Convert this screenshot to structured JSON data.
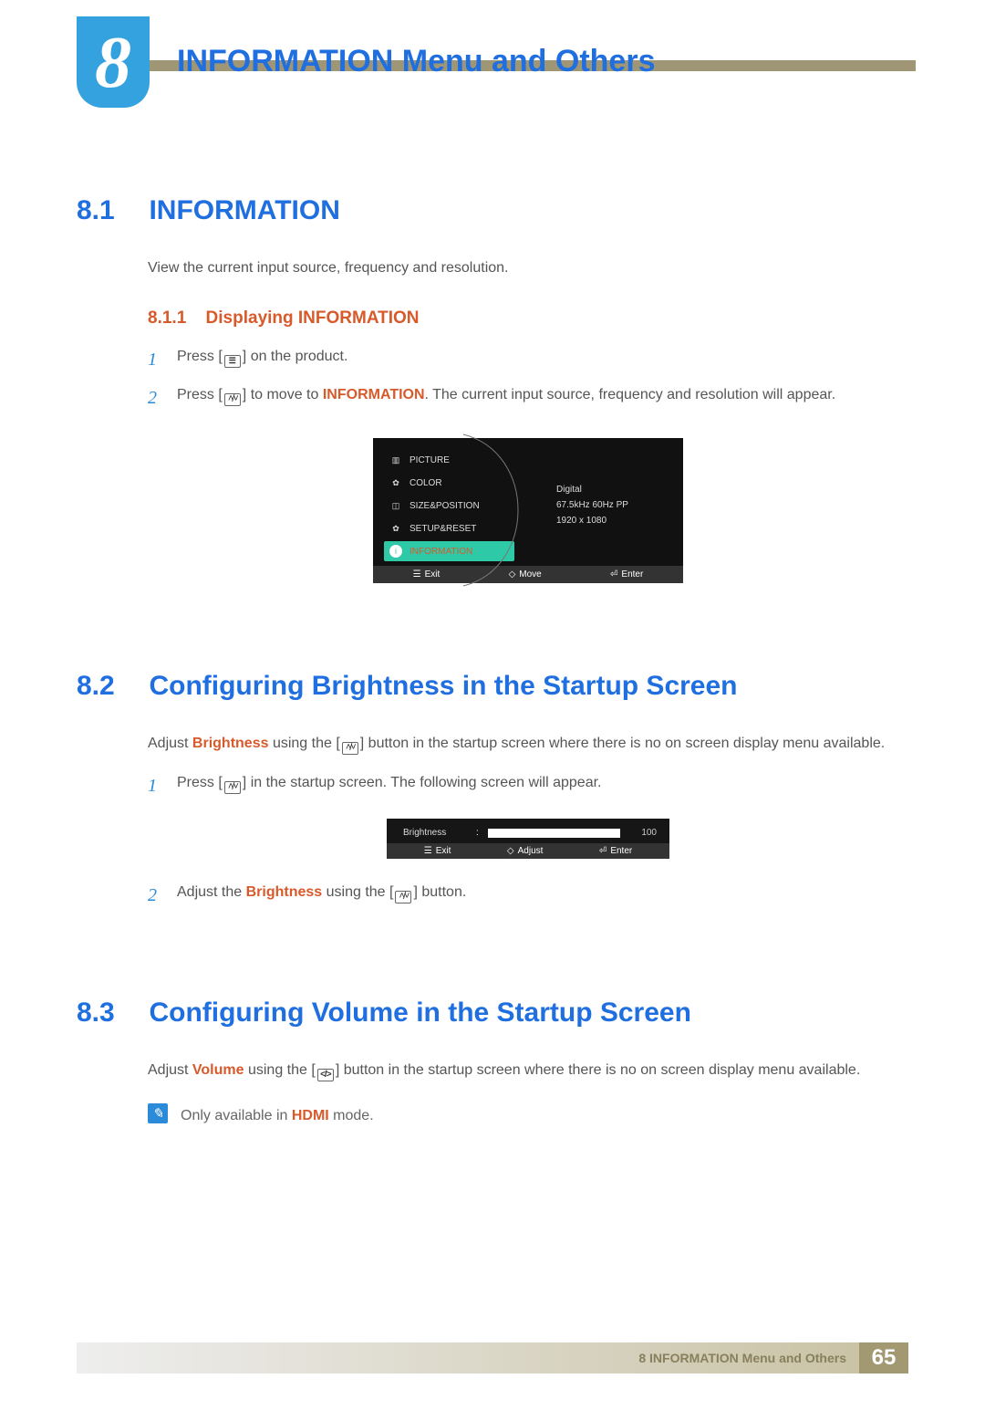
{
  "header": {
    "chapter_num": "8",
    "chapter_title": "INFORMATION Menu and Others"
  },
  "sec81": {
    "num": "8.1",
    "title": "INFORMATION",
    "desc": "View the current input source, frequency and resolution.",
    "sub_num": "8.1.1",
    "sub_title": "Displaying INFORMATION",
    "step1a": "Press [",
    "step1b": "] on the product.",
    "step2a": "Press [",
    "step2b": "] to move to ",
    "step2_kw": "INFORMATION",
    "step2c": ". The current input source, frequency and resolution will appear."
  },
  "osd": {
    "items": [
      "PICTURE",
      "COLOR",
      "SIZE&POSITION",
      "SETUP&RESET",
      "INFORMATION"
    ],
    "info1": "Digital",
    "info2": "67.5kHz 60Hz PP",
    "info3": "1920 x 1080",
    "foot_exit": "Exit",
    "foot_move": "Move",
    "foot_enter": "Enter"
  },
  "sec82": {
    "num": "8.2",
    "title": "Configuring Brightness in the Startup Screen",
    "desc1": "Adjust ",
    "desc_kw": "Brightness",
    "desc2": " using the [",
    "desc3": "] button in the startup screen where there is no on screen display menu available.",
    "step1a": "Press [",
    "step1b": "] in the startup screen. The following screen will appear.",
    "step2a": "Adjust the ",
    "step2_kw": "Brightness",
    "step2b": " using the [",
    "step2c": "] button."
  },
  "bosd": {
    "label": "Brightness",
    "colon": ":",
    "value": "100",
    "foot_exit": "Exit",
    "foot_adjust": "Adjust",
    "foot_enter": "Enter"
  },
  "sec83": {
    "num": "8.3",
    "title": "Configuring Volume in the Startup Screen",
    "desc1": "Adjust ",
    "desc_kw": "Volume",
    "desc2": " using the [",
    "desc3": "] button in the startup screen where there is no on screen display menu available.",
    "note1": "Only available in ",
    "note_kw": "HDMI",
    "note2": " mode."
  },
  "footer": {
    "text": "8 INFORMATION Menu and Others",
    "page": "65"
  },
  "glyph": {
    "menu": "☰",
    "updown": "˄/˅",
    "leftright": "</>",
    "diamond": "◇",
    "enter": "⏎"
  }
}
